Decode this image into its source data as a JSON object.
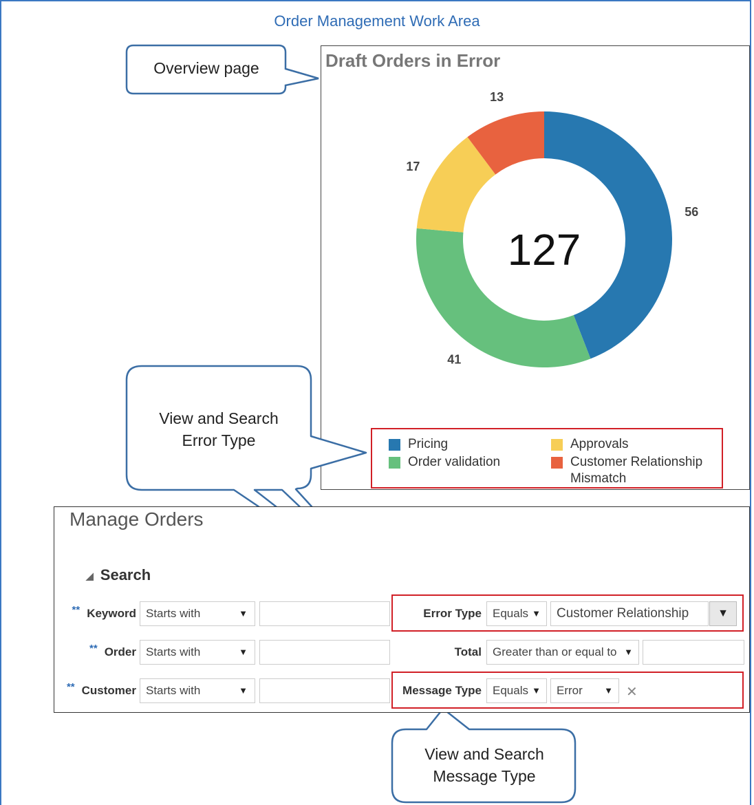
{
  "page": {
    "title": "Order Management Work Area"
  },
  "chart": {
    "title": "Draft Orders in Error",
    "center_total": "127",
    "slices": [
      {
        "name": "Pricing",
        "value": 56,
        "label": "56",
        "color": "#2778b0"
      },
      {
        "name": "Order validation",
        "value": 41,
        "label": "41",
        "color": "#66c07d"
      },
      {
        "name": "Approvals",
        "value": 17,
        "label": "17",
        "color": "#f7ce56"
      },
      {
        "name": "Customer Relationship Mismatch",
        "value": 13,
        "label": "13",
        "color": "#e8623f"
      }
    ]
  },
  "chart_data": {
    "type": "pie",
    "title": "Draft Orders in Error",
    "categories": [
      "Pricing",
      "Order validation",
      "Approvals",
      "Customer Relationship Mismatch"
    ],
    "values": [
      56,
      41,
      17,
      13
    ],
    "total": 127,
    "legend": "bottom"
  },
  "legend": {
    "pricing": "Pricing",
    "order_validation": "Order validation",
    "approvals": "Approvals",
    "crm_line1": "Customer Relationship",
    "crm_line2": "Mismatch"
  },
  "callouts": {
    "overview": "Overview page",
    "error_type_1": "View and Search",
    "error_type_2": "Error Type",
    "message_type_1": "View and Search",
    "message_type_2": "Message Type"
  },
  "manage": {
    "title": "Manage Orders",
    "search_label": "Search",
    "required_marker": "**",
    "rows": [
      {
        "label": "Keyword",
        "operator": "Starts with"
      },
      {
        "label": "Order",
        "operator": "Starts with"
      },
      {
        "label": "Customer",
        "operator": "Starts with"
      }
    ],
    "error_type": {
      "label": "Error Type",
      "operator": "Equals",
      "value": "Customer Relationship"
    },
    "total": {
      "label": "Total",
      "operator": "Greater than or equal to"
    },
    "message_type": {
      "label": "Message Type",
      "operator": "Equals",
      "value": "Error"
    }
  },
  "colors": {
    "accent": "#2f6cb5",
    "highlight": "#d11f26",
    "callout_border": "#3b6ea5"
  }
}
